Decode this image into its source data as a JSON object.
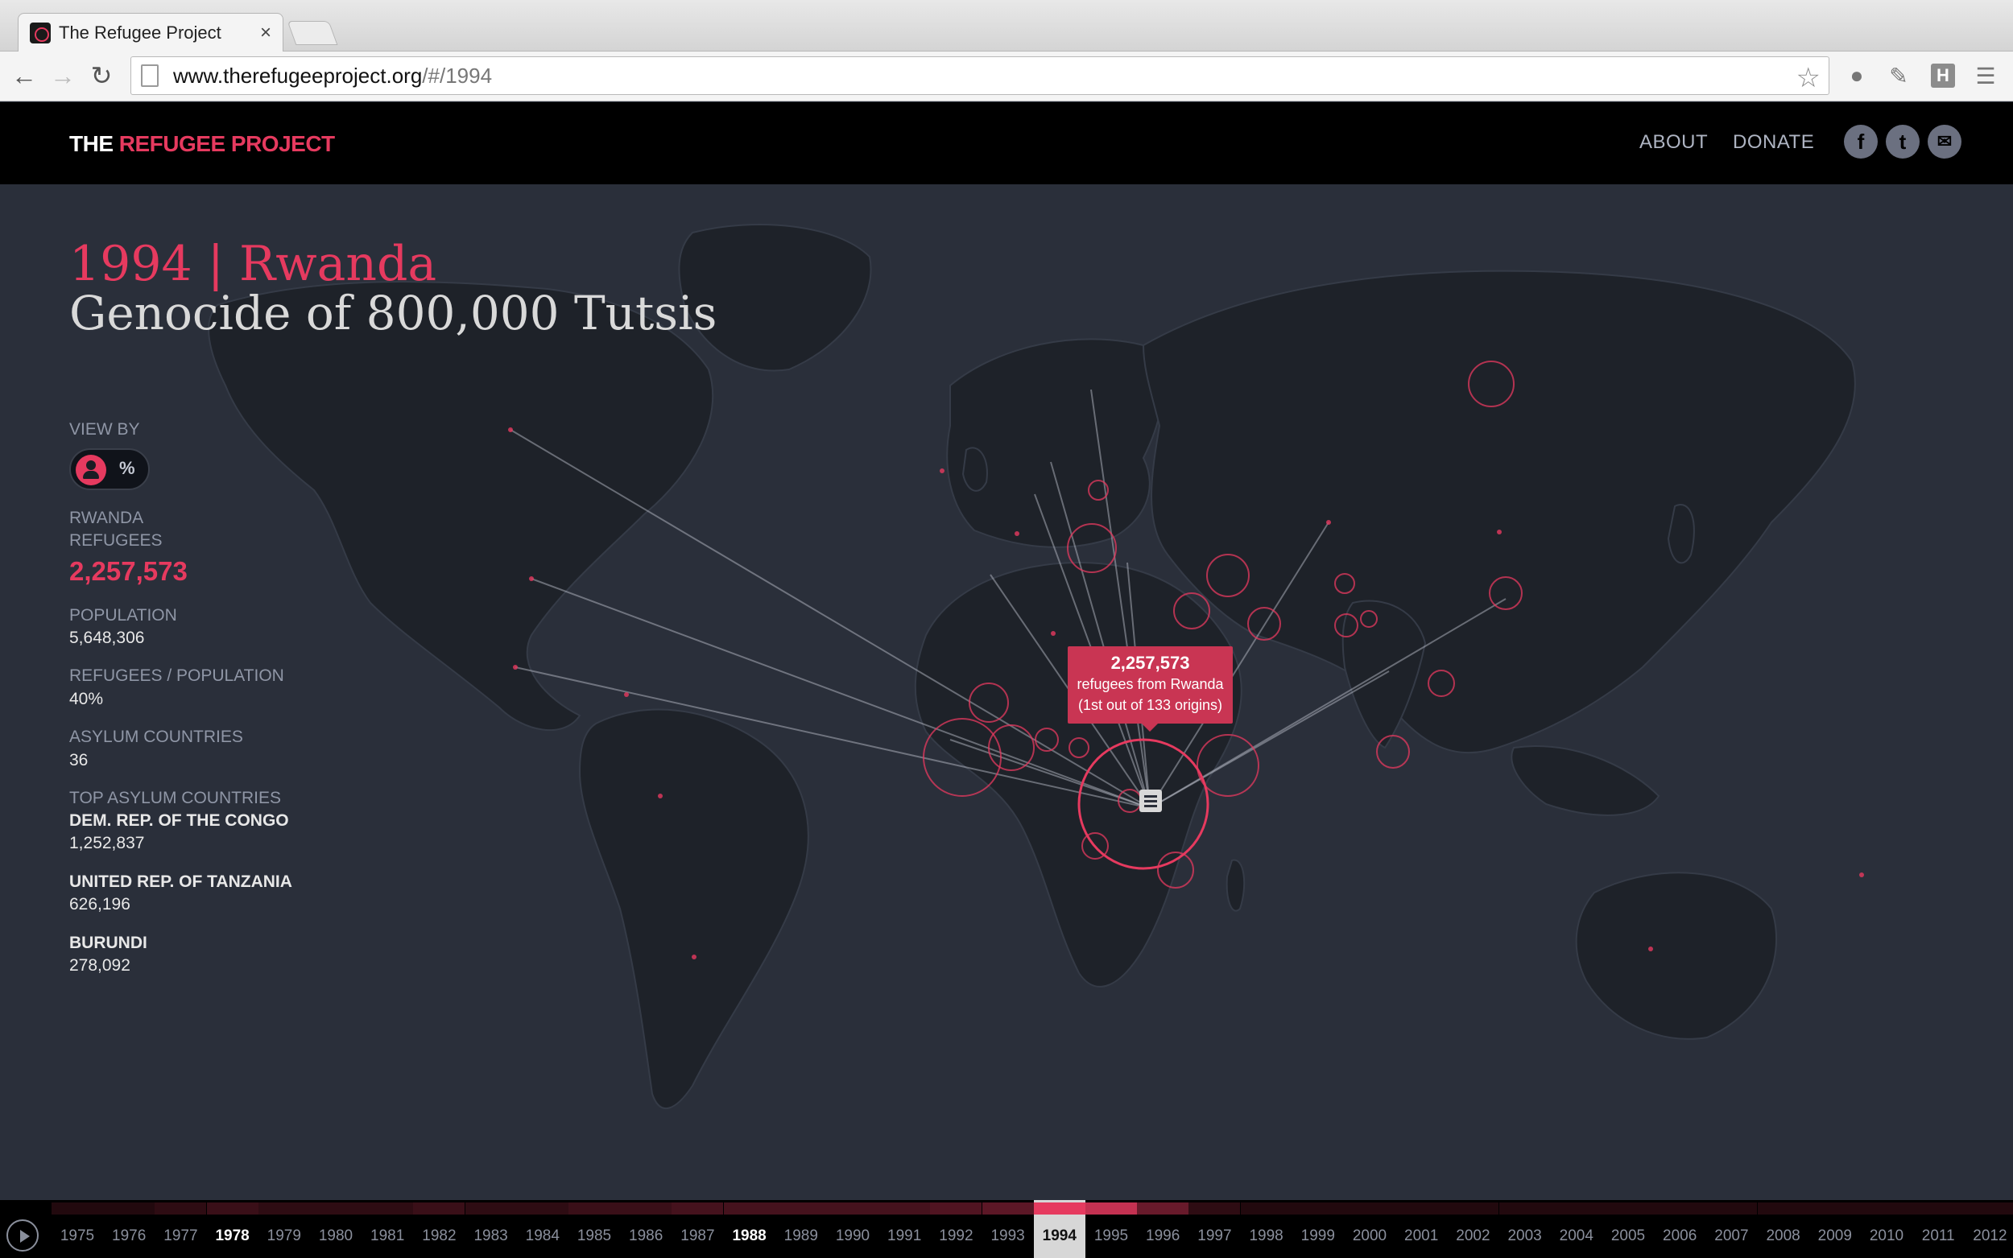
{
  "browser": {
    "tab_title": "The Refugee Project",
    "tab_close": "×",
    "url_host": "www.therefugeeproject.org",
    "url_path": "/#/1994",
    "ext_h_label": "H"
  },
  "site": {
    "logo_white": "THE ",
    "logo_red": "REFUGEE PROJECT",
    "nav": [
      "ABOUT",
      "DONATE"
    ],
    "social_icons": [
      "facebook-icon",
      "twitter-icon",
      "mail-icon"
    ],
    "social_glyphs": [
      "f",
      "t",
      "✉"
    ]
  },
  "story": {
    "title_line1": "1994 | Rwanda",
    "title_line2": "Genocide of 800,000 Tutsis"
  },
  "panel": {
    "view_by_label": "VIEW BY",
    "toggle_pct": "%",
    "refugees_label_1": "RWANDA",
    "refugees_label_2": "REFUGEES",
    "refugees_value": "2,257,573",
    "population_label": "POPULATION",
    "population_value": "5,648,306",
    "ratio_label": "REFUGEES / POPULATION",
    "ratio_value": "40%",
    "asylum_label": "ASYLUM COUNTRIES",
    "asylum_value": "36",
    "top_label": "TOP ASYLUM COUNTRIES",
    "top_countries": [
      {
        "name": "DEM. REP. OF THE CONGO",
        "value": "1,252,837"
      },
      {
        "name": "UNITED REP. OF TANZANIA",
        "value": "626,196"
      },
      {
        "name": "BURUNDI",
        "value": "278,092"
      }
    ]
  },
  "tooltip": {
    "count": "2,257,573",
    "line1": "refugees from Rwanda",
    "line2": "(1st out of 133 origins)"
  },
  "timeline": {
    "selected_year": "1994",
    "major_years": [
      "1978",
      "1988"
    ],
    "years": [
      "1975",
      "1976",
      "1977",
      "1978",
      "1979",
      "1980",
      "1981",
      "1982",
      "1983",
      "1984",
      "1985",
      "1986",
      "1987",
      "1988",
      "1989",
      "1990",
      "1991",
      "1992",
      "1993",
      "1994",
      "1995",
      "1996",
      "1997",
      "1998",
      "1999",
      "2000",
      "2001",
      "2002",
      "2003",
      "2004",
      "2005",
      "2006",
      "2007",
      "2008",
      "2009",
      "2010",
      "2011",
      "2012"
    ],
    "intensity": [
      0.15,
      0.15,
      0.2,
      0.25,
      0.2,
      0.2,
      0.2,
      0.25,
      0.2,
      0.2,
      0.25,
      0.25,
      0.3,
      0.3,
      0.3,
      0.3,
      0.3,
      0.35,
      0.4,
      1.0,
      0.85,
      0.45,
      0.2,
      0.15,
      0.15,
      0.15,
      0.15,
      0.15,
      0.15,
      0.15,
      0.15,
      0.15,
      0.15,
      0.15,
      0.15,
      0.15,
      0.15,
      0.15
    ],
    "accent": "#e63a5f"
  }
}
